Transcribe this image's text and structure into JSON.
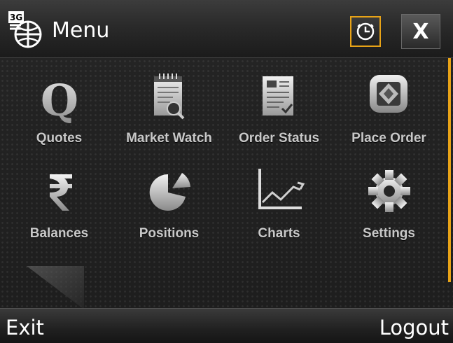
{
  "header": {
    "title": "Menu",
    "network_badge": "3G",
    "close_label": "X"
  },
  "menu": {
    "items": [
      {
        "label": "Quotes",
        "icon": "quotes-icon"
      },
      {
        "label": "Market Watch",
        "icon": "market-watch-icon"
      },
      {
        "label": "Order Status",
        "icon": "order-status-icon"
      },
      {
        "label": "Place Order",
        "icon": "place-order-icon"
      },
      {
        "label": "Balances",
        "icon": "rupee-icon"
      },
      {
        "label": "Positions",
        "icon": "pie-chart-icon"
      },
      {
        "label": "Charts",
        "icon": "line-chart-icon"
      },
      {
        "label": "Settings",
        "icon": "gear-icon"
      }
    ]
  },
  "softkeys": {
    "left": "Exit",
    "right": "Logout"
  },
  "colors": {
    "accent": "#e8a317",
    "label": "#c8c8c8",
    "background": "#1f1f1f"
  }
}
